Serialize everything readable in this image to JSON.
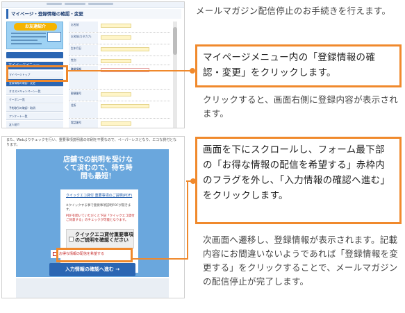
{
  "shot1": {
    "page_title": "マイページ・登録情報の確認・変更",
    "banner": {
      "title": "お友達紹介"
    },
    "menu_header": "マイページメニュー",
    "menu_items": [
      {
        "label": "マイページトップ"
      },
      {
        "label": "登録情報の確認・変更"
      },
      {
        "label": "オススメキャンペーン一覧"
      },
      {
        "label": "クーポン一覧"
      },
      {
        "label": "予約取引の確認・取消"
      },
      {
        "label": "アンケート一覧"
      },
      {
        "label": "友人紹介"
      },
      {
        "label": "退会"
      }
    ],
    "form_labels": [
      "お名前",
      "お名前(カタカナ)",
      "生年月日",
      "性別",
      "職業情報",
      "郵便番号",
      "住所",
      "電話番号"
    ]
  },
  "shot2": {
    "top_note": "また、Webよりチェックを行い、重要事項説明書の印刷を不要なので、ペーパーレスとなり、エコな貸付となります。",
    "panel_heading": "店舗での説明を受けなくて済むので、待ち時間も最短！",
    "link_text": "クイックエコ貸付 重要事項のご説明(PDF)",
    "note1": "※クイックする事で重要事項説明PDFが開きます。",
    "note2": "PDFを開いていただくと下記「クイックエコ貸付 ご同意する」のチェックが可能となります。",
    "check_label": "クイックエコ貸付重要事項のご説明を確認ください",
    "optin_label": "お得な情報の配信を希望する",
    "submit_label": "入力情報の確認へ進む →"
  },
  "instructions": {
    "text1": "メールマガジン配信停止のお手続きを行えます。",
    "callout1": "マイページメニュー内の「登録情報の確認・変更」をクリックします。",
    "text2": "クリックすると、画面右側に登録内容が表示されます。",
    "callout2": "画面を下にスクロールし、フォーム最下部の「お得な情報の配信を希望する」赤枠内のフラグを外し、「入力情報の確認へ進む」をクリックします。",
    "text4": "次画面へ遷移し、登録情報が表示されます。記載内容にお間違いないようであれば「登録情報を変更する」をクリックすることで、メールマガジンの配信停止が完了します。"
  },
  "colors": {
    "accent": "#f0892c",
    "brand_blue": "#2b66b3",
    "panel_blue": "#6aa7dd",
    "warning_red": "#c21f1f"
  }
}
